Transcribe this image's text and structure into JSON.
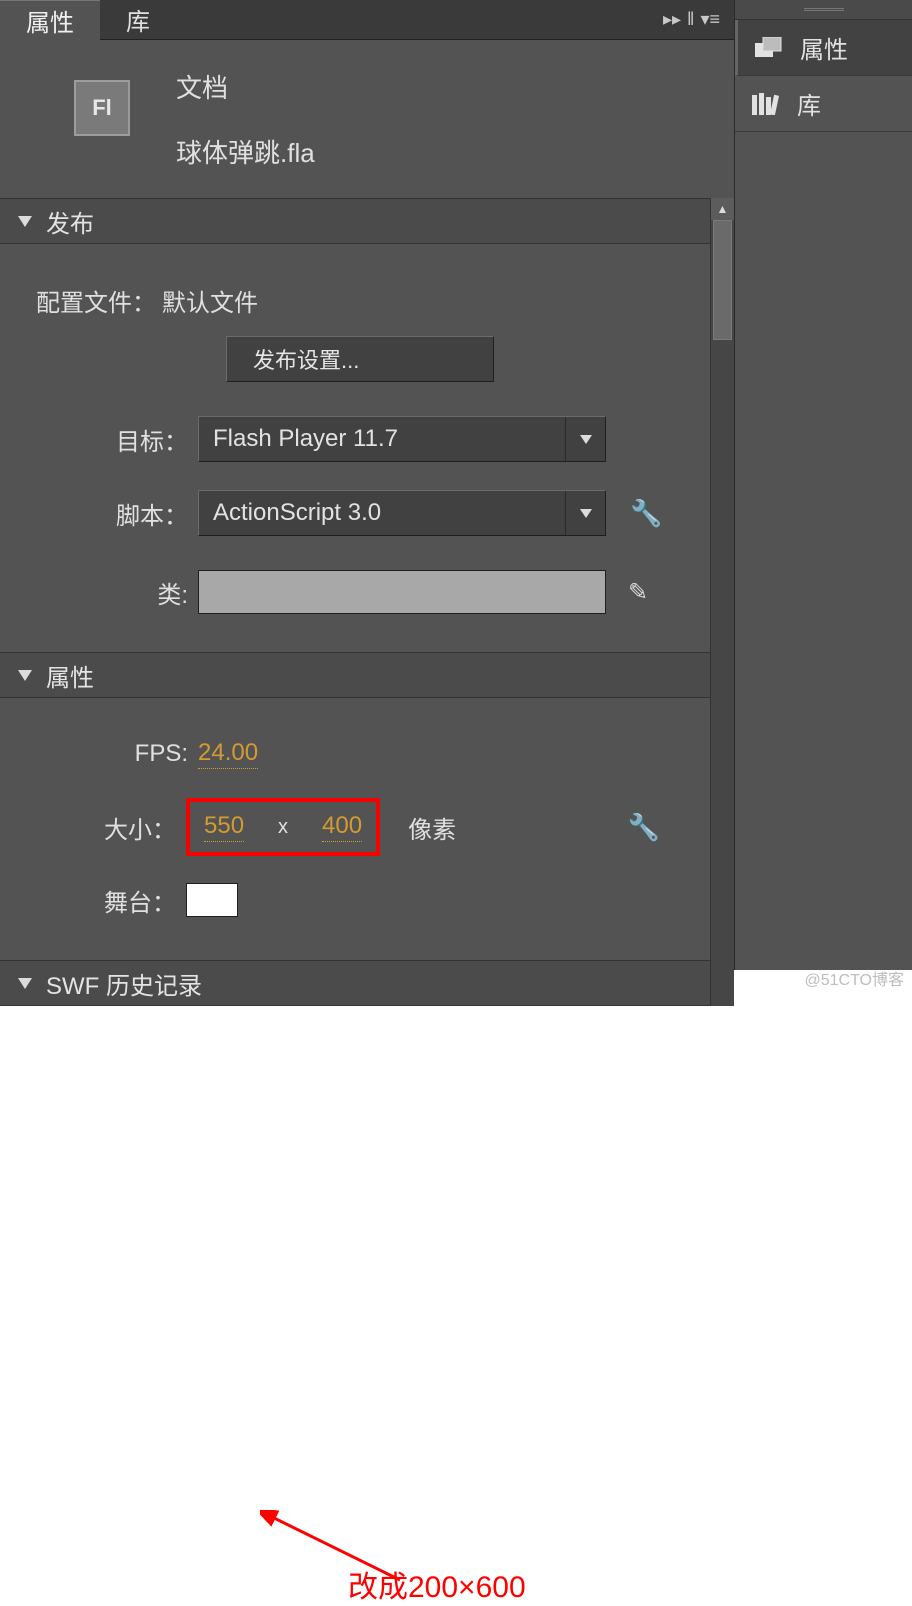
{
  "tabs": {
    "properties": "属性",
    "library": "库"
  },
  "doc": {
    "fl": "Fl",
    "type": "文档",
    "filename": "球体弹跳.fla"
  },
  "sections": {
    "publish": {
      "title": "发布",
      "profile_label": "配置文件：",
      "profile_value": "默认文件",
      "publish_settings_btn": "发布设置...",
      "target_label": "目标：",
      "target_value": "Flash Player 11.7",
      "script_label": "脚本：",
      "script_value": "ActionScript 3.0",
      "class_label": "类:"
    },
    "props": {
      "title": "属性",
      "fps_label": "FPS:",
      "fps_value": "24.00",
      "size_label": "大小：",
      "width": "550",
      "height": "400",
      "sep": "x",
      "unit": "像素",
      "stage_label": "舞台："
    },
    "swf": {
      "title": "SWF 历史记录"
    }
  },
  "annotation": "改成200×600",
  "right": {
    "properties": "属性",
    "library": "库"
  },
  "watermark": "@51CTO博客"
}
